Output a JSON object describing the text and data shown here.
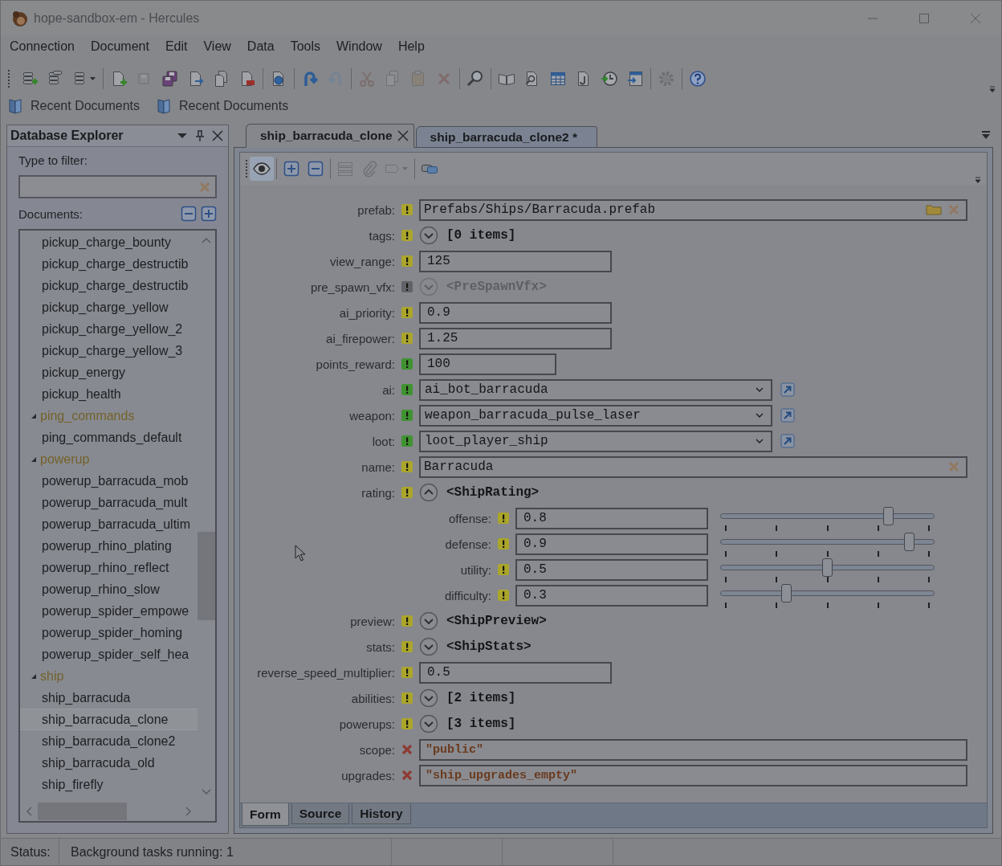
{
  "window": {
    "title": "hope-sandbox-em - Hercules"
  },
  "menu": [
    "Connection",
    "Document",
    "Edit",
    "View",
    "Data",
    "Tools",
    "Window",
    "Help"
  ],
  "toolbar": [
    [
      {
        "disabled": false
      },
      {
        "disabled": false
      },
      {
        "disabled": false
      }
    ],
    [
      {
        "disabled": false
      },
      {
        "disabled": true
      },
      {
        "disabled": false
      },
      {
        "disabled": false
      },
      {
        "disabled": false
      },
      {
        "disabled": false
      }
    ],
    [
      {
        "disabled": false
      }
    ],
    [
      {
        "disabled": false
      },
      {
        "disabled": true
      }
    ],
    [
      {
        "disabled": true
      },
      {
        "disabled": true
      },
      {
        "disabled": true
      },
      {
        "disabled": true
      }
    ],
    [
      {
        "disabled": false
      }
    ],
    [
      {
        "disabled": false
      },
      {
        "disabled": false
      },
      {
        "disabled": false
      },
      {
        "disabled": false
      },
      {
        "disabled": false
      },
      {
        "disabled": false
      }
    ],
    [
      {
        "disabled": true
      }
    ],
    [
      {
        "disabled": false
      }
    ]
  ],
  "recent_documents": [
    "Recent Documents",
    "Recent Documents"
  ],
  "explorer": {
    "title": "Database Explorer",
    "filter_label": "Type to filter:",
    "documents_label": "Documents:",
    "tree": [
      {
        "kind": "document",
        "label": "pickup_charge_bounty",
        "selected": false
      },
      {
        "kind": "document",
        "label": "pickup_charge_destructib",
        "selected": false
      },
      {
        "kind": "document",
        "label": "pickup_charge_destructib",
        "selected": false
      },
      {
        "kind": "document",
        "label": "pickup_charge_yellow",
        "selected": false
      },
      {
        "kind": "document",
        "label": "pickup_charge_yellow_2",
        "selected": false
      },
      {
        "kind": "document",
        "label": "pickup_charge_yellow_3",
        "selected": false
      },
      {
        "kind": "document",
        "label": "pickup_energy",
        "selected": false
      },
      {
        "kind": "document",
        "label": "pickup_health",
        "selected": false
      },
      {
        "kind": "folder",
        "label": "ping_commands",
        "selected": false,
        "expanded": true,
        "children": [
          {
            "kind": "document",
            "label": "ping_commands_default",
            "selected": false
          }
        ]
      },
      {
        "kind": "folder",
        "label": "powerup",
        "selected": false,
        "expanded": true,
        "children": [
          {
            "kind": "document",
            "label": "powerup_barracuda_mob",
            "selected": false
          },
          {
            "kind": "document",
            "label": "powerup_barracuda_mult",
            "selected": false
          },
          {
            "kind": "document",
            "label": "powerup_barracuda_ultim",
            "selected": false
          },
          {
            "kind": "document",
            "label": "powerup_rhino_plating",
            "selected": false
          },
          {
            "kind": "document",
            "label": "powerup_rhino_reflect",
            "selected": false
          },
          {
            "kind": "document",
            "label": "powerup_rhino_slow",
            "selected": false
          },
          {
            "kind": "document",
            "label": "powerup_spider_empowe",
            "selected": false
          },
          {
            "kind": "document",
            "label": "powerup_spider_homing",
            "selected": false
          },
          {
            "kind": "document",
            "label": "powerup_spider_self_hea",
            "selected": false
          }
        ]
      },
      {
        "kind": "folder",
        "label": "ship",
        "selected": false,
        "expanded": true,
        "children": [
          {
            "kind": "document",
            "label": "ship_barracuda",
            "selected": false
          },
          {
            "kind": "document",
            "label": "ship_barracuda_clone",
            "selected": true
          },
          {
            "kind": "document",
            "label": "ship_barracuda_clone2",
            "selected": false
          },
          {
            "kind": "document",
            "label": "ship_barracuda_old",
            "selected": false
          },
          {
            "kind": "document",
            "label": "ship_firefly",
            "selected": false
          }
        ]
      }
    ]
  },
  "document_tabs": [
    {
      "label": "ship_barracuda_clone",
      "selected": true
    },
    {
      "label": "ship_barracuda_clone2 *",
      "selected": false
    }
  ],
  "document_toolbar": [
    [
      {
        "selected": true,
        "disabled": false
      }
    ],
    [
      {
        "selected": false,
        "disabled": false
      },
      {
        "selected": false,
        "disabled": false
      }
    ],
    [
      {
        "selected": false,
        "disabled": true
      },
      {
        "selected": false,
        "disabled": true
      },
      {
        "selected": false,
        "disabled": true
      }
    ],
    [
      {
        "selected": false,
        "disabled": false
      }
    ]
  ],
  "fields": [
    {
      "label": "prefab:",
      "marker": {
        "kind": "exclamation",
        "color": "#aba52b"
      },
      "kind": "path",
      "value": "Prefabs/Ships/Barracuda.prefab",
      "disabled": false
    },
    {
      "label": "tags:",
      "marker": {
        "kind": "exclamation",
        "color": "#aba52b"
      },
      "kind": "list",
      "value": "[0 items]",
      "expanded": false,
      "disabled": false
    },
    {
      "label": "view_range:",
      "marker": {
        "kind": "exclamation",
        "color": "#aba52b"
      },
      "kind": "number",
      "value": "125",
      "disabled": false
    },
    {
      "label": "pre_spawn_vfx:",
      "marker": {
        "kind": "exclamation",
        "color": "#606267"
      },
      "kind": "object",
      "value": "<PreSpawnVfx>",
      "expanded": false,
      "disabled": true
    },
    {
      "label": "ai_priority:",
      "marker": {
        "kind": "exclamation",
        "color": "#aba52b"
      },
      "kind": "number",
      "value": "0.9",
      "disabled": false
    },
    {
      "label": "ai_firepower:",
      "marker": {
        "kind": "exclamation",
        "color": "#aba52b"
      },
      "kind": "number",
      "value": "1.25",
      "disabled": false
    },
    {
      "label": "points_reward:",
      "marker": {
        "kind": "exclamation",
        "color": "#3f9330"
      },
      "kind": "integer",
      "value": "100",
      "disabled": false
    },
    {
      "label": "ai:",
      "marker": {
        "kind": "exclamation",
        "color": "#3f9330"
      },
      "kind": "choice",
      "value": "ai_bot_barracuda",
      "disabled": false
    },
    {
      "label": "weapon:",
      "marker": {
        "kind": "exclamation",
        "color": "#3f9330"
      },
      "kind": "choice",
      "value": "weapon_barracuda_pulse_laser",
      "disabled": false
    },
    {
      "label": "loot:",
      "marker": {
        "kind": "exclamation",
        "color": "#3f9330"
      },
      "kind": "choice",
      "value": "loot_player_ship",
      "disabled": false
    },
    {
      "label": "name:",
      "marker": {
        "kind": "exclamation",
        "color": "#aba52b"
      },
      "kind": "string",
      "value": "Barracuda",
      "disabled": false
    },
    {
      "label": "rating:",
      "marker": {
        "kind": "exclamation",
        "color": "#aba52b"
      },
      "kind": "object",
      "value": "<ShipRating>",
      "expanded": true,
      "disabled": false,
      "children": [
        {
          "label": "offense:",
          "marker": {
            "kind": "exclamation",
            "color": "#aba52b"
          },
          "kind": "slider",
          "value": "0.8",
          "level": 0.8,
          "disabled": false
        },
        {
          "label": "defense:",
          "marker": {
            "kind": "exclamation",
            "color": "#aba52b"
          },
          "kind": "slider",
          "value": "0.9",
          "level": 0.9,
          "disabled": false
        },
        {
          "label": "utility:",
          "marker": {
            "kind": "exclamation",
            "color": "#aba52b"
          },
          "kind": "slider",
          "value": "0.5",
          "level": 0.5,
          "disabled": false
        },
        {
          "label": "difficulty:",
          "marker": {
            "kind": "exclamation",
            "color": "#aba52b"
          },
          "kind": "slider",
          "value": "0.3",
          "level": 0.3,
          "disabled": false
        }
      ]
    },
    {
      "label": "preview:",
      "marker": {
        "kind": "exclamation",
        "color": "#aba52b"
      },
      "kind": "object",
      "value": "<ShipPreview>",
      "expanded": false,
      "disabled": false
    },
    {
      "label": "stats:",
      "marker": {
        "kind": "exclamation",
        "color": "#aba52b"
      },
      "kind": "object",
      "value": "<ShipStats>",
      "expanded": false,
      "disabled": false
    },
    {
      "label": "reverse_speed_multiplier:",
      "marker": {
        "kind": "exclamation",
        "color": "#aba52b"
      },
      "kind": "number",
      "value": "0.5",
      "disabled": false
    },
    {
      "label": "abilities:",
      "marker": {
        "kind": "exclamation",
        "color": "#aba52b"
      },
      "kind": "list",
      "value": "[2 items]",
      "expanded": false,
      "disabled": false
    },
    {
      "label": "powerups:",
      "marker": {
        "kind": "exclamation",
        "color": "#aba52b"
      },
      "kind": "list",
      "value": "[3 items]",
      "expanded": false,
      "disabled": false
    },
    {
      "label": "scope:",
      "marker": {
        "kind": "cross",
        "color": "#8d3b33"
      },
      "kind": "raw",
      "value": "\"public\"",
      "disabled": false
    },
    {
      "label": "upgrades:",
      "marker": {
        "kind": "cross",
        "color": "#8d3b33"
      },
      "kind": "raw",
      "value": "\"ship_upgrades_empty\"",
      "disabled": false
    }
  ],
  "view_tabs": [
    {
      "label": "Form",
      "selected": true
    },
    {
      "label": "Source",
      "selected": false
    },
    {
      "label": "History",
      "selected": false
    }
  ],
  "status_bar": {
    "label": "Status:",
    "message": "Background tasks running: 1"
  }
}
